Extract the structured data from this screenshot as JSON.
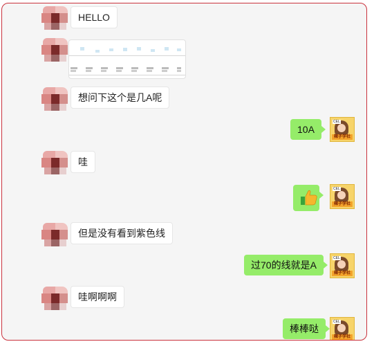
{
  "messages": [
    {
      "side": "left",
      "text": "HELLO"
    },
    {
      "side": "left",
      "type": "image"
    },
    {
      "side": "left",
      "text": "想问下这个是几A呢"
    },
    {
      "side": "right",
      "text": "10A"
    },
    {
      "side": "left",
      "text": "哇"
    },
    {
      "side": "right",
      "type": "emoji",
      "emoji": "thumbs-up-icon"
    },
    {
      "side": "left",
      "text": "但是没有看到紫色线"
    },
    {
      "side": "right",
      "text": "过70的线就是A"
    },
    {
      "side": "left",
      "text": "哇啊啊啊"
    },
    {
      "side": "right",
      "text": "棒棒哒"
    }
  ],
  "me_avatar_label": "辣子学社",
  "me_avatar_tag": "CEL",
  "colors": {
    "frame_border": "#c9303b",
    "my_bubble": "#95ec69",
    "their_bubble": "#ffffff",
    "background": "#f5f5f5"
  }
}
